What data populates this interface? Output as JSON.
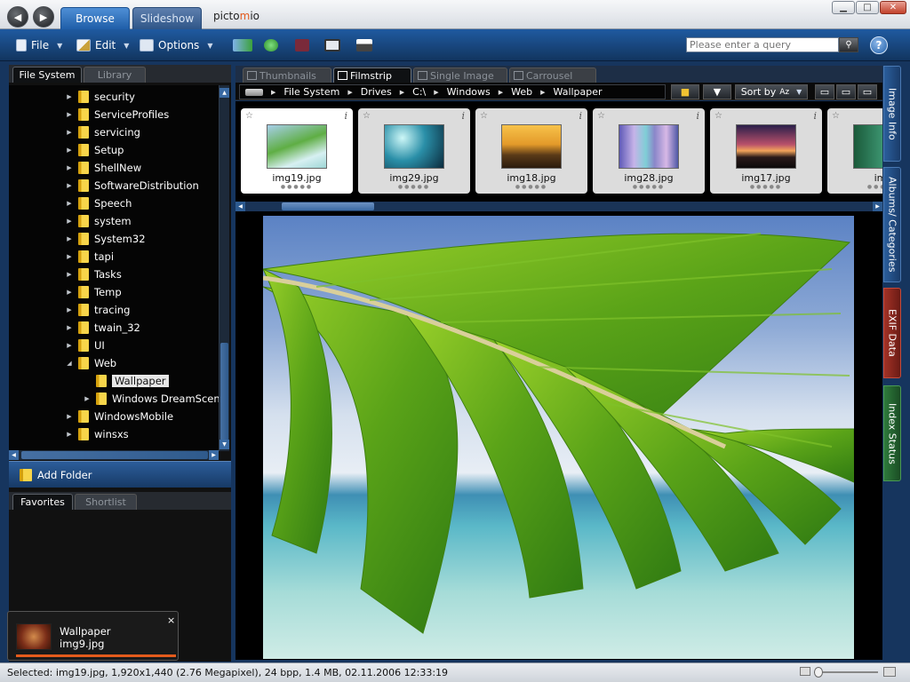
{
  "titlebar": {
    "tabs": [
      {
        "label": "Browse",
        "active": true
      },
      {
        "label": "Slideshow",
        "active": false
      }
    ],
    "logo": {
      "left": "picto",
      "mid": "m",
      "right": "io"
    }
  },
  "toolbar": {
    "file_label": "File",
    "edit_label": "Edit",
    "options_label": "Options",
    "search_placeholder": "Please enter a query",
    "help_label": "?"
  },
  "leftpanel": {
    "tabs": [
      {
        "label": "File System",
        "active": true
      },
      {
        "label": "Library",
        "active": false
      }
    ],
    "tree": [
      {
        "label": "security",
        "level": 0,
        "expander": "collapsed"
      },
      {
        "label": "ServiceProfiles",
        "level": 0,
        "expander": "collapsed"
      },
      {
        "label": "servicing",
        "level": 0,
        "expander": "collapsed"
      },
      {
        "label": "Setup",
        "level": 0,
        "expander": "collapsed"
      },
      {
        "label": "ShellNew",
        "level": 0,
        "expander": "collapsed"
      },
      {
        "label": "SoftwareDistribution",
        "level": 0,
        "expander": "collapsed"
      },
      {
        "label": "Speech",
        "level": 0,
        "expander": "collapsed"
      },
      {
        "label": "system",
        "level": 0,
        "expander": "collapsed"
      },
      {
        "label": "System32",
        "level": 0,
        "expander": "collapsed"
      },
      {
        "label": "tapi",
        "level": 0,
        "expander": "collapsed"
      },
      {
        "label": "Tasks",
        "level": 0,
        "expander": "collapsed"
      },
      {
        "label": "Temp",
        "level": 0,
        "expander": "collapsed"
      },
      {
        "label": "tracing",
        "level": 0,
        "expander": "collapsed"
      },
      {
        "label": "twain_32",
        "level": 0,
        "expander": "collapsed"
      },
      {
        "label": "UI",
        "level": 0,
        "expander": "collapsed"
      },
      {
        "label": "Web",
        "level": 0,
        "expander": "expanded"
      },
      {
        "label": "Wallpaper",
        "level": 1,
        "expander": "none",
        "selected": true
      },
      {
        "label": "Windows DreamScene",
        "level": 1,
        "expander": "collapsed"
      },
      {
        "label": "WindowsMobile",
        "level": 0,
        "expander": "collapsed"
      },
      {
        "label": "winsxs",
        "level": 0,
        "expander": "collapsed"
      }
    ],
    "add_folder_label": "Add Folder",
    "bottom_tabs": [
      {
        "label": "Favorites",
        "active": true
      },
      {
        "label": "Shortlist",
        "active": false
      }
    ]
  },
  "popup": {
    "title": "Wallpaper",
    "filename": "img9.jpg",
    "close": "×"
  },
  "viewtabs": [
    {
      "label": "Thumbnails",
      "active": false
    },
    {
      "label": "Filmstrip",
      "active": true
    },
    {
      "label": "Single Image",
      "active": false
    },
    {
      "label": "Carrousel",
      "active": false
    }
  ],
  "breadcrumb": [
    "File System",
    "Drives",
    "C:\\",
    "Windows",
    "Web",
    "Wallpaper"
  ],
  "sort": {
    "label": "Sort by",
    "order_icon": "Az"
  },
  "filmstrip": [
    {
      "name": "img19.jpg",
      "active": true
    },
    {
      "name": "img29.jpg",
      "active": false
    },
    {
      "name": "img18.jpg",
      "active": false
    },
    {
      "name": "img28.jpg",
      "active": false
    },
    {
      "name": "img17.jpg",
      "active": false
    },
    {
      "name": "img",
      "active": false
    }
  ],
  "sidetabs": [
    {
      "label": "Image Info"
    },
    {
      "label": "Albums/ Categories"
    },
    {
      "label": "EXIF Data"
    },
    {
      "label": "Index Status"
    }
  ],
  "status": {
    "text": "Selected: img19.jpg, 1,920x1,440 (2.76 Megapixel), 24 bpp, 1.4 MB, 02.11.2006 12:33:19"
  },
  "colors": {
    "accent": "#1f5ea8",
    "toolbar": "#12355f",
    "exif_tab": "#a33227",
    "index_tab": "#2e7a3c",
    "popup_bar": "#e45b1c"
  }
}
